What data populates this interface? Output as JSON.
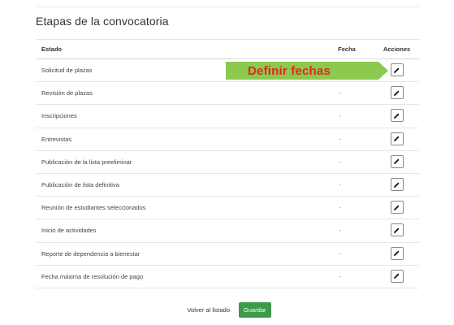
{
  "section": {
    "title": "Etapas de la convocatoria"
  },
  "table": {
    "headers": {
      "estado": "Estado",
      "fecha": "Fecha",
      "acciones": "Acciones"
    },
    "rows": [
      {
        "estado": "Solicitud de plazas",
        "fecha": ""
      },
      {
        "estado": "Revisión de plazas",
        "fecha": "-"
      },
      {
        "estado": "Inscripciones",
        "fecha": "-"
      },
      {
        "estado": "Entrevistas",
        "fecha": "-"
      },
      {
        "estado": "Publicación de la lista preeliminar",
        "fecha": "-"
      },
      {
        "estado": "Publicación de lista definitiva",
        "fecha": "-"
      },
      {
        "estado": "Reunión de estudiantes seleccionados",
        "fecha": "-"
      },
      {
        "estado": "Inicio de actividades",
        "fecha": "-"
      },
      {
        "estado": "Reporte de dependencia a bienestar",
        "fecha": "-"
      },
      {
        "estado": "Fecha máxima de resolución de pago",
        "fecha": "-"
      }
    ],
    "action_icon": "pencil-icon"
  },
  "callout": {
    "text": "Definir fechas",
    "bg_color": "#8bc94f",
    "text_color": "#e8261c"
  },
  "footer": {
    "back_label": "Volver al listado",
    "save_label": "Guardar",
    "save_color": "#3d9a4a"
  }
}
